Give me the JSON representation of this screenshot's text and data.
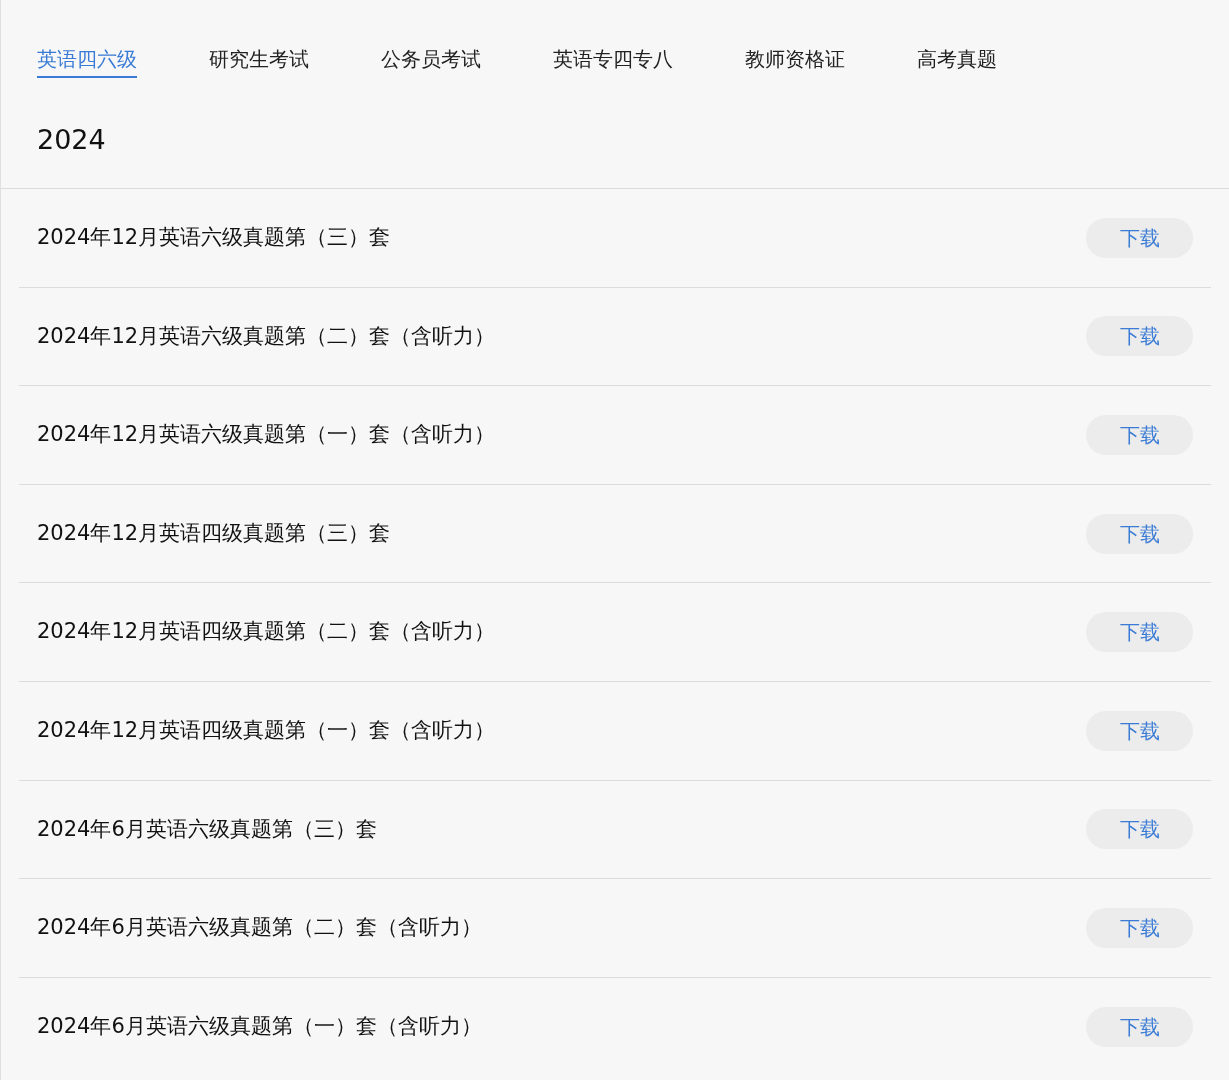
{
  "tabs": [
    {
      "label": "英语四六级",
      "selected": true
    },
    {
      "label": "研究生考试",
      "selected": false
    },
    {
      "label": "公务员考试",
      "selected": false
    },
    {
      "label": "英语专四专八",
      "selected": false
    },
    {
      "label": "教师资格证",
      "selected": false
    },
    {
      "label": "高考真题",
      "selected": false
    }
  ],
  "year": "2024",
  "papers": [
    {
      "title": "2024年12月英语六级真题第（三）套",
      "action": "下载"
    },
    {
      "title": "2024年12月英语六级真题第（二）套（含听力）",
      "action": "下载"
    },
    {
      "title": "2024年12月英语六级真题第（一）套（含听力）",
      "action": "下载"
    },
    {
      "title": "2024年12月英语四级真题第（三）套",
      "action": "下载"
    },
    {
      "title": "2024年12月英语四级真题第（二）套（含听力）",
      "action": "下载"
    },
    {
      "title": "2024年12月英语四级真题第（一）套（含听力）",
      "action": "下载"
    },
    {
      "title": "2024年6月英语六级真题第（三）套",
      "action": "下载"
    },
    {
      "title": "2024年6月英语六级真题第（二）套（含听力）",
      "action": "下载"
    },
    {
      "title": "2024年6月英语六级真题第（一）套（含听力）",
      "action": "下载"
    }
  ]
}
